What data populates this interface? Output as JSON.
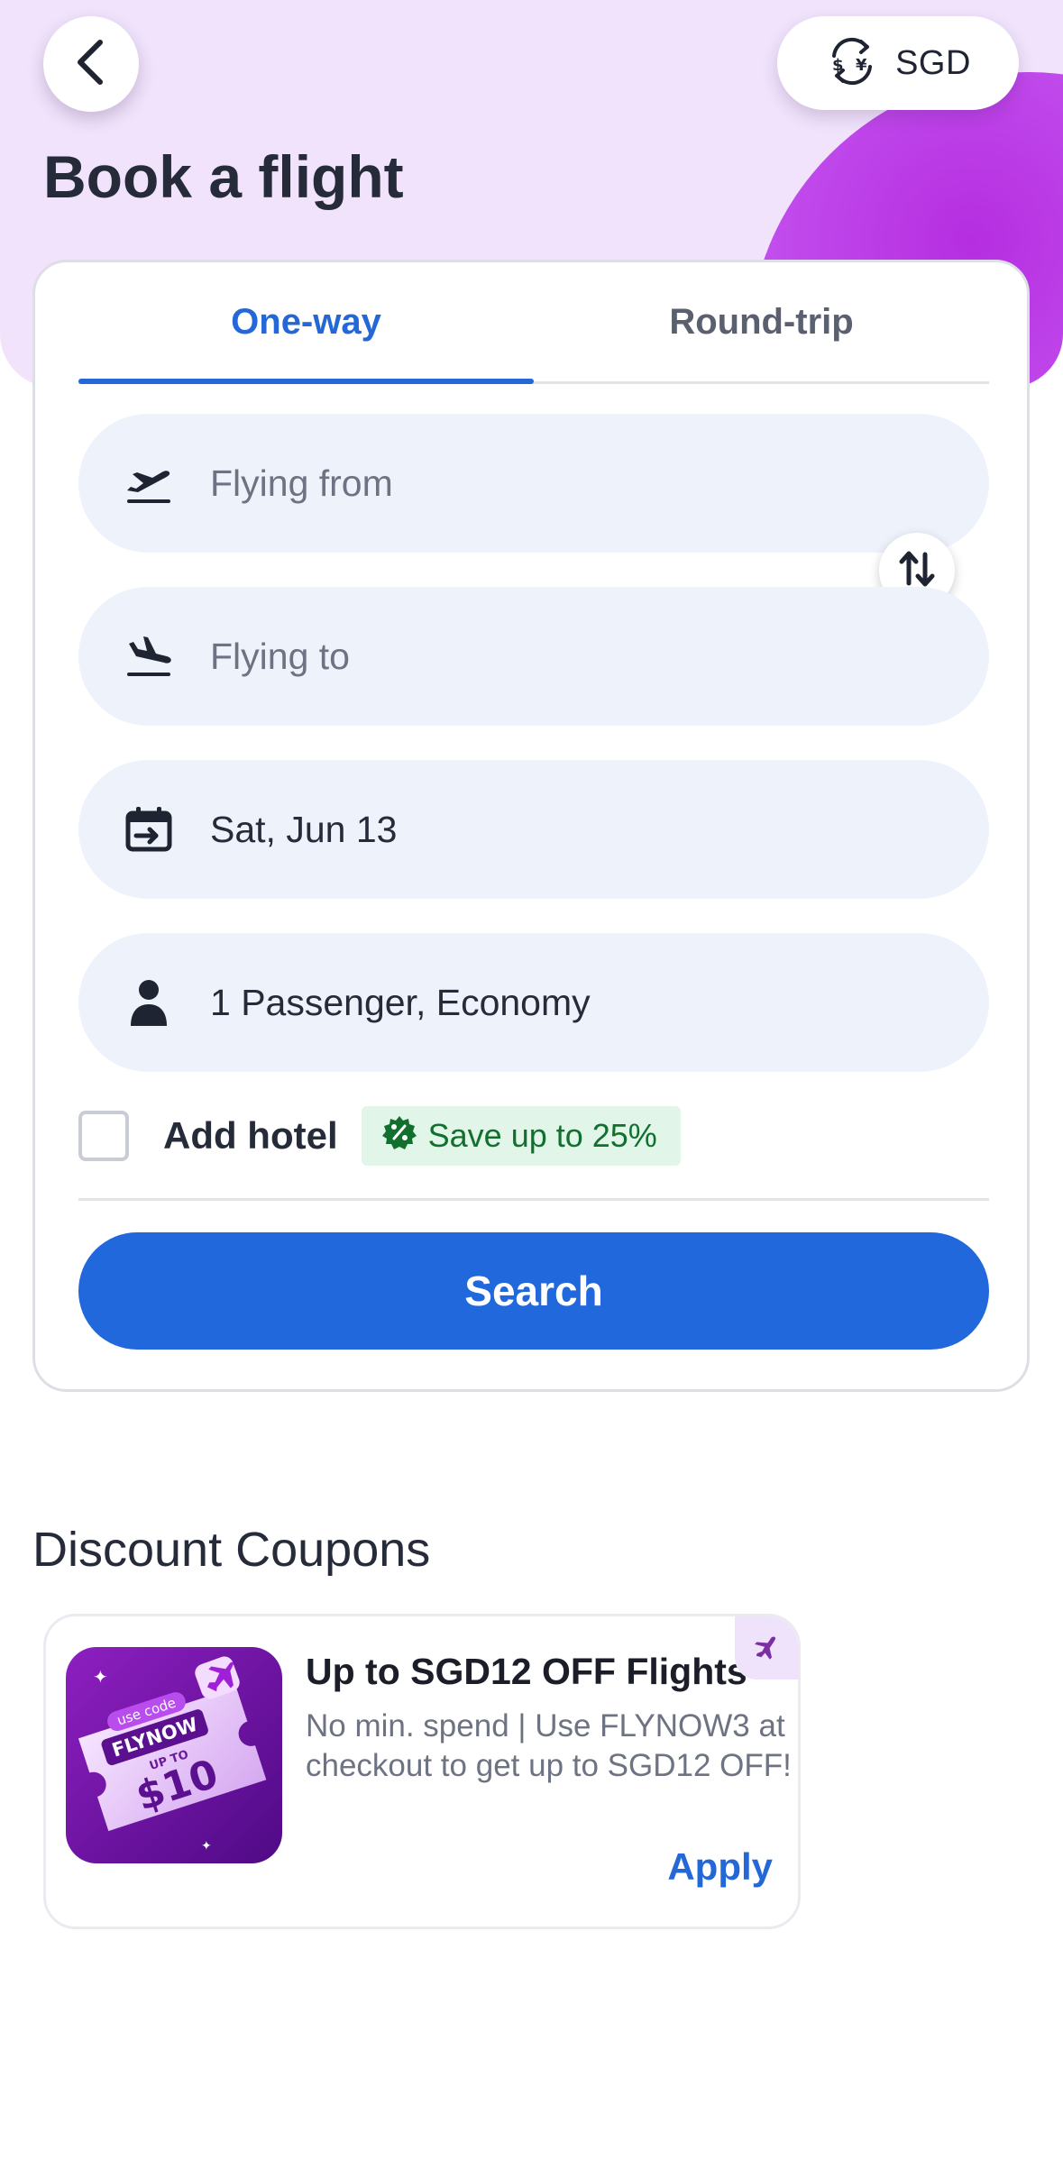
{
  "header": {
    "title": "Book a flight",
    "currency": "SGD",
    "back_icon": "chevron-left-icon",
    "currency_icon": "currency-exchange-icon"
  },
  "tabs": [
    {
      "label": "One-way",
      "selected": true
    },
    {
      "label": "Round-trip",
      "selected": false
    }
  ],
  "form": {
    "from": {
      "placeholder": "Flying from",
      "icon": "takeoff-icon"
    },
    "to": {
      "placeholder": "Flying to",
      "icon": "landing-icon"
    },
    "date": {
      "value": "Sat, Jun 13",
      "icon": "calendar-icon"
    },
    "passengers": {
      "value": "1 Passenger, Economy",
      "icon": "person-icon"
    },
    "swap_icon": "swap-vertical-icon",
    "add_hotel": {
      "label": "Add hotel",
      "checked": false
    },
    "save_badge": "Save up to 25%",
    "search_label": "Search"
  },
  "coupons": {
    "section_title": "Discount Coupons",
    "items": [
      {
        "title": "Up to SGD12 OFF Flights",
        "description": "No min. spend | Use FLYNOW3 at checkout to get up to SGD12 OFF!",
        "apply_label": "Apply",
        "image_text": {
          "use_code": "use code",
          "code": "FLYNOW",
          "up_to": "UP TO",
          "amount": "$10"
        }
      }
    ]
  },
  "colors": {
    "accent": "#2467d6",
    "search_button": "#2168dc",
    "hero_bg": "#f0e3fb",
    "badge_bg": "#e1f5e8",
    "badge_text": "#12702f"
  }
}
